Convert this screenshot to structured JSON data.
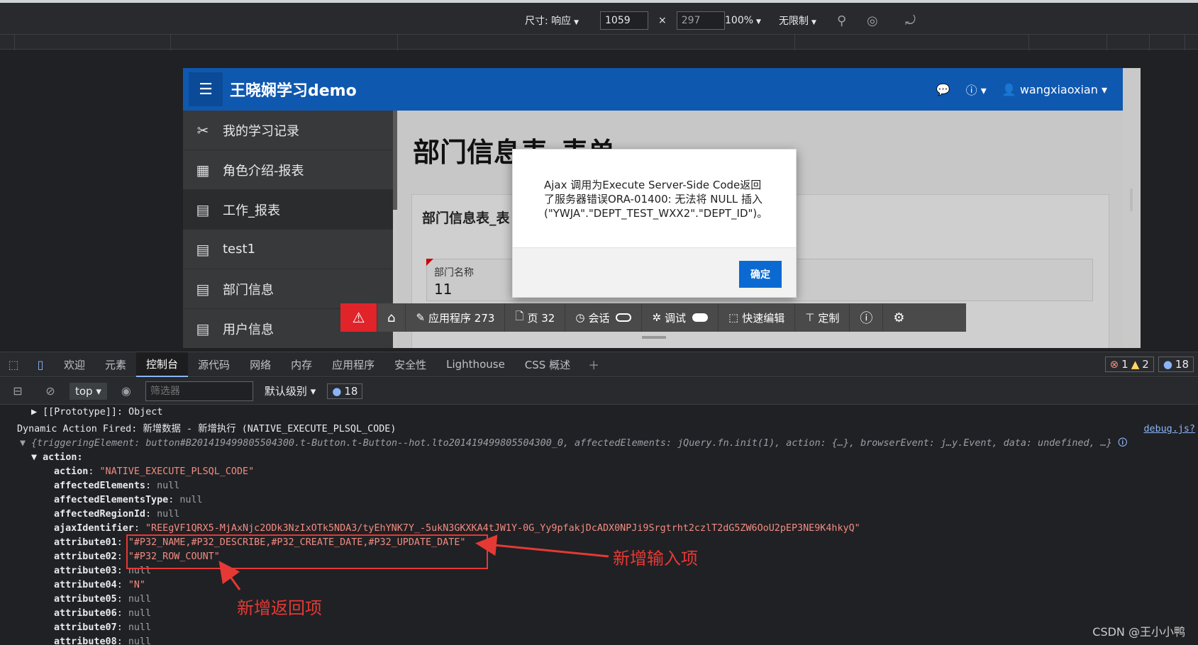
{
  "devtools_toolbar": {
    "size_label": "尺寸: 响应",
    "width": "1059",
    "times": "×",
    "height": "297",
    "zoom": "100%",
    "throttle": "无限制"
  },
  "app": {
    "title": "王晓娴学习demo",
    "user": "wangxiaoxian",
    "menu": [
      {
        "icon": "tools-icon",
        "label": "我的学习记录"
      },
      {
        "icon": "table-icon",
        "label": "角色介绍-报表"
      },
      {
        "icon": "form-table-icon",
        "label": "工作_报表"
      },
      {
        "icon": "form-table-icon",
        "label": "test1"
      },
      {
        "icon": "form-table-icon",
        "label": "部门信息"
      },
      {
        "icon": "form-table-icon",
        "label": "用户信息"
      }
    ],
    "page_title": "部门信息表_表单",
    "region_title": "部门信息表_表",
    "field_label": "部门名称",
    "field_value": "11"
  },
  "dialog": {
    "message": "Ajax 调用为Execute Server-Side Code返回了服务器错误ORA-01400: 无法将 NULL 插入 (\"YWJA\".\"DEPT_TEST_WXX2\".\"DEPT_ID\")。",
    "ok": "确定"
  },
  "dev_toolbar": {
    "app": "应用程序 273",
    "page": "页 32",
    "session": "会话",
    "debug": "调试",
    "quick_edit": "快速编辑",
    "customize": "定制"
  },
  "devtools_tabs": [
    "欢迎",
    "元素",
    "控制台",
    "源代码",
    "网络",
    "内存",
    "应用程序",
    "安全性",
    "Lighthouse",
    "CSS 概述"
  ],
  "devtools_badges": {
    "errors": "1",
    "warnings": "2",
    "messages": "18"
  },
  "console_toolbar": {
    "context": "top",
    "filter_placeholder": "筛选器",
    "level": "默认级别",
    "count": "18"
  },
  "console": {
    "prototype": "[[Prototype]]: Object",
    "fired": "Dynamic Action Fired: 新增数据 - 新增执行 (NATIVE_EXECUTE_PLSQL_CODE)",
    "source_link": "debug.js?",
    "summary": "{triggeringElement: button#B201419499805504300.t-Button.t-Button--hot.lto201419499805504300_0, affectedElements: jQuery.fn.init(1), action: {…}, browserEvent: j…y.Event, data: undefined, …}",
    "action_key": "action:",
    "props": [
      {
        "k": "action",
        "v": "\"NATIVE_EXECUTE_PLSQL_CODE\"",
        "t": "s"
      },
      {
        "k": "affectedElements",
        "v": "null",
        "t": "n"
      },
      {
        "k": "affectedElementsType",
        "v": "null",
        "t": "n"
      },
      {
        "k": "affectedRegionId",
        "v": "null",
        "t": "n"
      },
      {
        "k": "ajaxIdentifier",
        "v": "\"REEgVF1QRX5-MjAxNjc2ODk3NzIxOTk5NDA3/tyEhYNK7Y_-5ukN3GKXKA4tJW1Y-0G_Yy9pfakjDcADX0NPJi9Srgtrht2czlT2dG5ZW6OoU2pEP3NE9K4hkyQ\"",
        "t": "s"
      },
      {
        "k": "attribute01",
        "v": "\"#P32_NAME,#P32_DESCRIBE,#P32_CREATE_DATE,#P32_UPDATE_DATE\"",
        "t": "s"
      },
      {
        "k": "attribute02",
        "v": "\"#P32_ROW_COUNT\"",
        "t": "s"
      },
      {
        "k": "attribute03",
        "v": "null",
        "t": "n"
      },
      {
        "k": "attribute04",
        "v": "\"N\"",
        "t": "s"
      },
      {
        "k": "attribute05",
        "v": "null",
        "t": "n"
      },
      {
        "k": "attribute06",
        "v": "null",
        "t": "n"
      },
      {
        "k": "attribute07",
        "v": "null",
        "t": "n"
      },
      {
        "k": "attribute08",
        "v": "null",
        "t": "n"
      }
    ]
  },
  "annotations": {
    "input": "新增输入项",
    "return": "新增返回项"
  },
  "watermark": "CSDN @王小小鸭"
}
